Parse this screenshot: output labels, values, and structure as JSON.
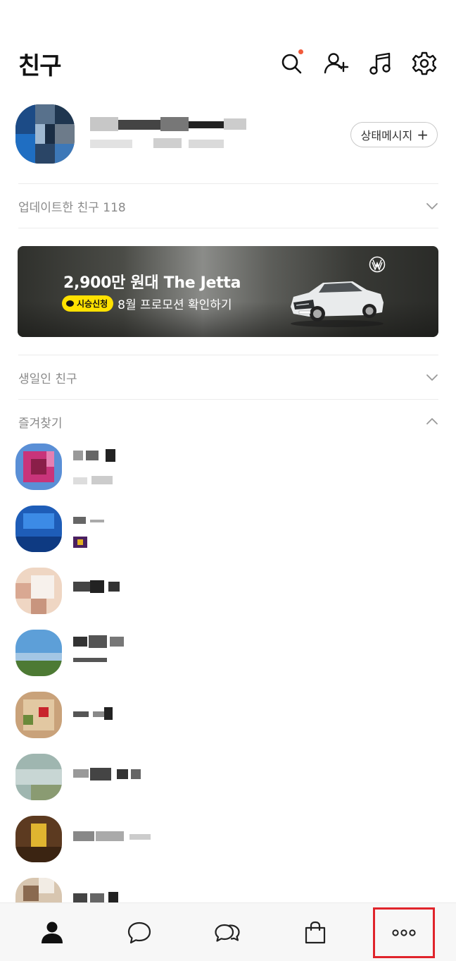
{
  "header": {
    "title": "친구",
    "icons": [
      "search-icon",
      "add-friend-icon",
      "music-icon",
      "settings-icon"
    ],
    "search_has_notification": true
  },
  "profile": {
    "status_button_label": "상태메시지",
    "status_button_plus": "+"
  },
  "sections": {
    "updated_friends": "업데이트한 친구 118",
    "birthday_friends": "생일인 친구",
    "favorites": "즐겨찾기"
  },
  "banner": {
    "title": "2,900만 원대 The Jetta",
    "badge": "시승신청",
    "subtitle": "8월 프로모션 확인하기",
    "logo": "vw-logo"
  },
  "favorites_count_visible": 8,
  "tabbar": {
    "tabs": [
      "friends-tab",
      "chats-tab",
      "openchat-tab",
      "shopping-tab",
      "more-tab"
    ],
    "highlighted_tab": "more-tab",
    "highlight_color": "#e0242b"
  },
  "colors": {
    "accent_badge": "#ffe100",
    "notification_dot": "#f15a3b"
  }
}
